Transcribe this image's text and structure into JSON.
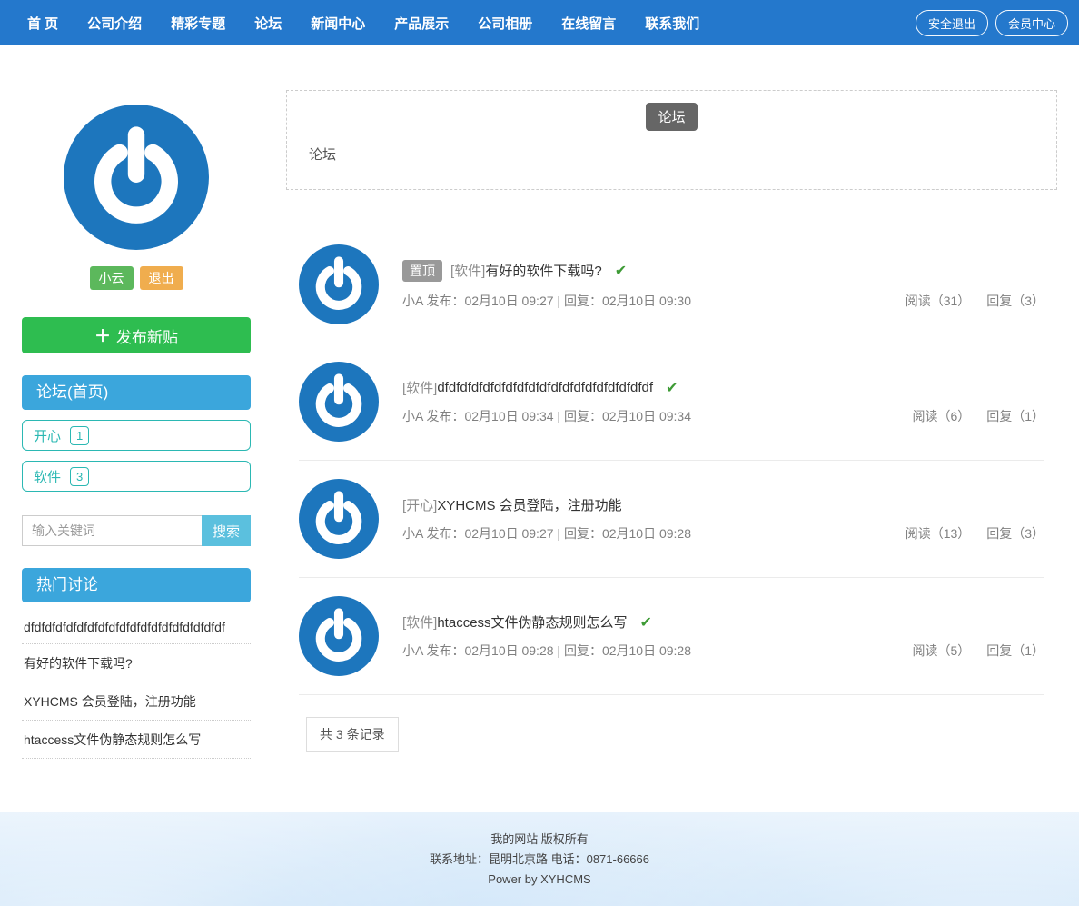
{
  "nav": {
    "items": [
      "首 页",
      "公司介绍",
      "精彩专题",
      "论坛",
      "新闻中心",
      "产品展示",
      "公司相册",
      "在线留言",
      "联系我们"
    ],
    "logout_label": "安全退出",
    "member_center_label": "会员中心"
  },
  "icons": {
    "plus": "＋",
    "check": "✔"
  },
  "colors": {
    "nav_blue": "#2478cc",
    "panel_blue": "#3ba6dc",
    "button_green": "#2ebd50",
    "teal": "#2bb8b3",
    "search_blue": "#5bc0de",
    "badge_green": "#5cb85c",
    "badge_orange": "#f0ad4e",
    "logo_blue": "#1d76bd",
    "check_green": "#3e9b36",
    "pin_gray": "#999999"
  },
  "sidebar": {
    "username_badge": "小云",
    "logout_badge": "退出",
    "new_post_label": "发布新贴",
    "forum_home_header": "论坛(首页)",
    "categories": [
      {
        "label": "开心",
        "count": "1"
      },
      {
        "label": "软件",
        "count": "3"
      }
    ],
    "search": {
      "placeholder": "输入关键词",
      "button_label": "搜索"
    },
    "hot_header": "热门讨论",
    "hot_items": [
      "dfdfdfdfdfdfdfdfdfdfdfdfdfdfdfdfdfdfdf",
      "有好的软件下载吗?",
      "XYHCMS 会员登陆，注册功能",
      "htaccess文件伪静态规则怎么写"
    ]
  },
  "main": {
    "box_badge": "论坛",
    "breadcrumb": "论坛",
    "posts": [
      {
        "pin": "置顶",
        "category": "[软件]",
        "title": "有好的软件下载吗?",
        "meta": "小A 发布：02月10日 09:27 | 回复：02月10日 09:30",
        "reads": "阅读（31）",
        "replies": "回复（3）"
      },
      {
        "category": "[软件]",
        "title": "dfdfdfdfdfdfdfdfdfdfdfdfdfdfdfdfdfdfdf",
        "meta": "小A 发布：02月10日 09:34 | 回复：02月10日 09:34",
        "reads": "阅读（6）",
        "replies": "回复（1）"
      },
      {
        "category": "[开心]",
        "title": "XYHCMS 会员登陆，注册功能",
        "meta": "小A 发布：02月10日 09:27 | 回复：02月10日 09:28",
        "reads": "阅读（13）",
        "replies": "回复（3）"
      },
      {
        "category": "[软件]",
        "title": "htaccess文件伪静态规则怎么写",
        "meta": "小A 发布：02月10日 09:28 | 回复：02月10日 09:28",
        "reads": "阅读（5）",
        "replies": "回复（1）"
      }
    ],
    "records_label": "共 3 条记录"
  },
  "footer": {
    "line1": "我的网站 版权所有",
    "line2": "联系地址：昆明北京路 电话：0871-66666",
    "line3": "Power by XYHCMS"
  }
}
